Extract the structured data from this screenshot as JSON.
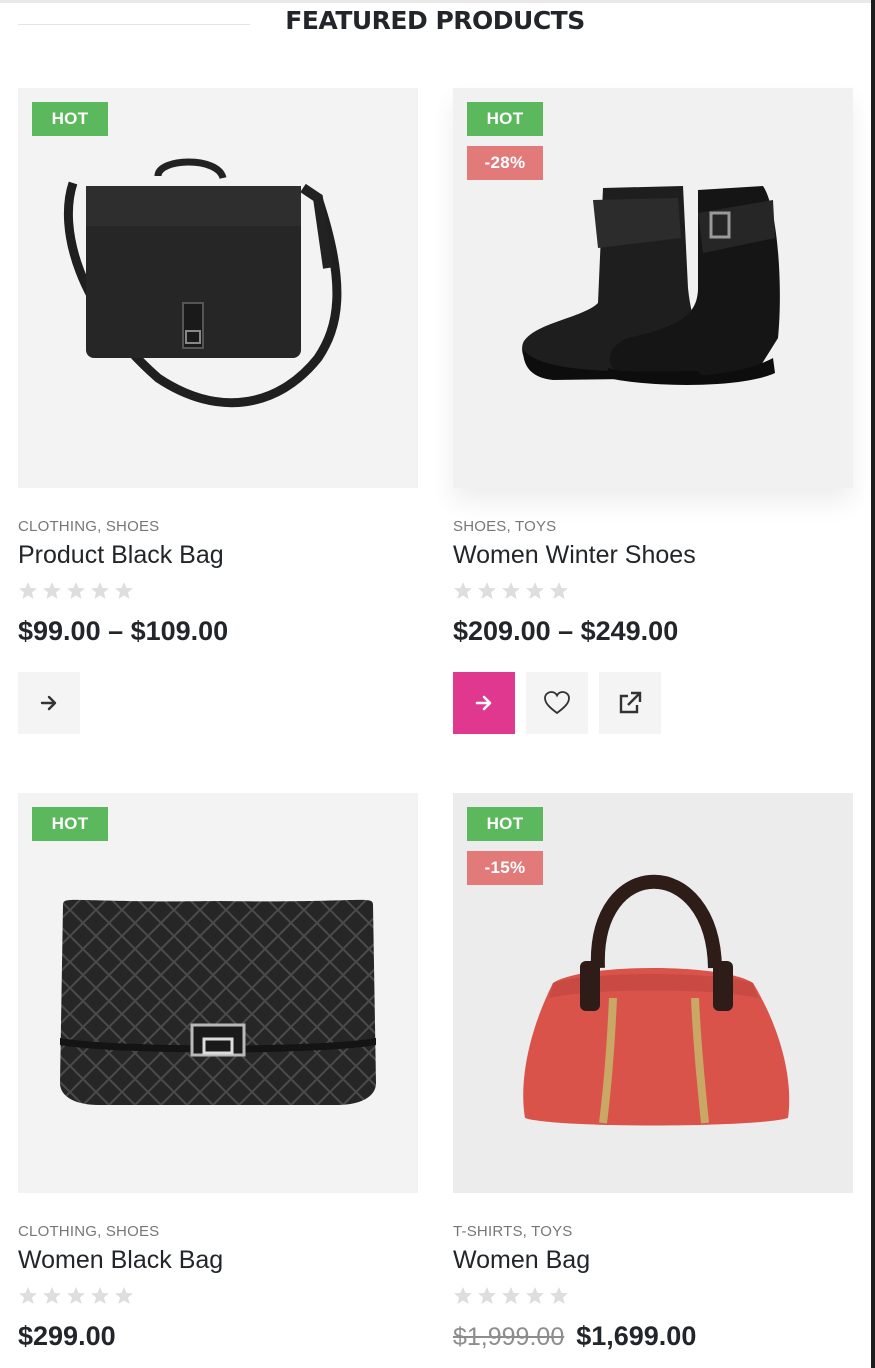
{
  "section": {
    "title": "FEATURED PRODUCTS"
  },
  "colors": {
    "hot": "#5cb85c",
    "sale": "#e37a7a",
    "accent": "#e0378f",
    "star_empty": "#dedede"
  },
  "products": [
    {
      "badge_hot": "HOT",
      "badge_sale": "",
      "categories": "CLOTHING, SHOES",
      "name": "Product Black Bag",
      "rating": 0,
      "price": "$99.00 – $109.00",
      "old_price": "",
      "image_icon": "black-messenger-bag"
    },
    {
      "badge_hot": "HOT",
      "badge_sale": "-28%",
      "categories": "SHOES, TOYS",
      "name": "Women Winter Shoes",
      "rating": 0,
      "price": "$209.00 – $249.00",
      "old_price": "",
      "image_icon": "black-ankle-boots"
    },
    {
      "badge_hot": "HOT",
      "badge_sale": "",
      "categories": "CLOTHING, SHOES",
      "name": "Women Black Bag",
      "rating": 0,
      "price": "$299.00",
      "old_price": "",
      "image_icon": "quilted-black-clutch"
    },
    {
      "badge_hot": "HOT",
      "badge_sale": "-15%",
      "categories": "T-SHIRTS, TOYS",
      "name": "Women Bag",
      "rating": 0,
      "price": "$1,699.00",
      "old_price": "$1,999.00",
      "image_icon": "red-handbag"
    }
  ],
  "actions": {
    "select_icon": "arrow-right-icon",
    "wishlist_icon": "heart-icon",
    "quickview_icon": "external-link-icon"
  }
}
